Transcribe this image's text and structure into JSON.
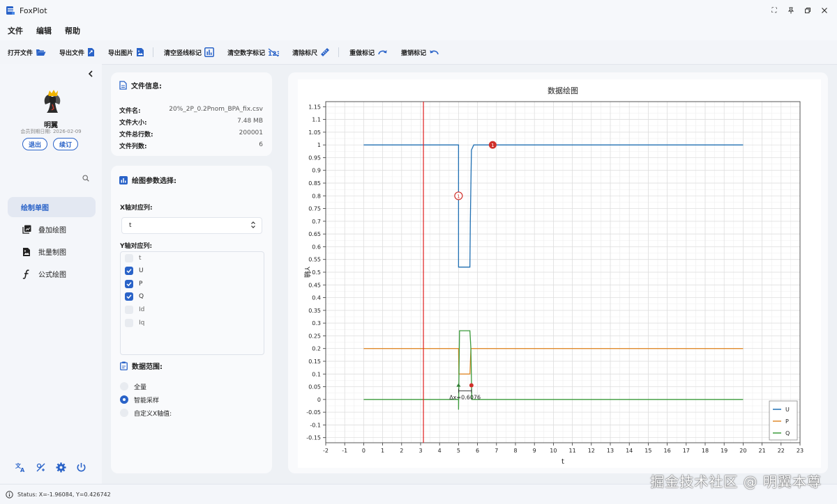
{
  "window": {
    "title": "FoxPlot",
    "controls": [
      "⛶",
      "📌",
      "🗗",
      "✕"
    ]
  },
  "menu": [
    "文件",
    "编辑",
    "帮助"
  ],
  "toolbar": {
    "open_file": "打开文件",
    "export_file": "导出文件",
    "export_image": "导出图片",
    "clear_vlines": "清空竖线标记",
    "clear_numbers": "清空数字标记",
    "clear_ruler": "清除标尺",
    "redo_mark": "重做标记",
    "undo_mark": "撤销标记"
  },
  "user": {
    "name": "明翼",
    "expire_label": "会员到期日期:",
    "expire_date": "2026-02-09",
    "logout": "退出",
    "renew": "续订"
  },
  "nav": [
    "绘制单图",
    "叠加绘图",
    "批量制图",
    "公式绘图"
  ],
  "file_info": {
    "title": "文件信息:",
    "rows": [
      {
        "k": "文件名:",
        "v": "20%_2P_0.2Pnom_BPA_fix.csv"
      },
      {
        "k": "文件大小:",
        "v": "7.48 MB"
      },
      {
        "k": "文件总行数:",
        "v": "200001"
      },
      {
        "k": "文件列数:",
        "v": "6"
      }
    ]
  },
  "params": {
    "title": "绘图参数选择:",
    "x_label": "X轴对应列:",
    "x_value": "t",
    "y_label": "Y轴对应列:",
    "y_columns": [
      {
        "name": "t",
        "checked": false
      },
      {
        "name": "U",
        "checked": true
      },
      {
        "name": "P",
        "checked": true
      },
      {
        "name": "Q",
        "checked": true
      },
      {
        "name": "Id",
        "checked": false
      },
      {
        "name": "Iq",
        "checked": false
      }
    ],
    "range_title": "数据范围:",
    "range_options": [
      {
        "name": "全量",
        "selected": false
      },
      {
        "name": "智能采样",
        "selected": true
      },
      {
        "name": "自定义X轴值:",
        "selected": false
      }
    ]
  },
  "status": "Status: X=-1.96084, Y=0.426742",
  "watermark": "掘金技术社区 @ 明翼本尊",
  "colors": {
    "accent": "#2a63c8",
    "U": "#1f6fb2",
    "P": "#e08a2c",
    "Q": "#3a9a3a",
    "marker": "#d0302a"
  },
  "chart_data": {
    "type": "line",
    "title": "数据绘图",
    "xlabel": "t",
    "ylabel": "Y轴",
    "xlim": [
      -2,
      23
    ],
    "ylim": [
      -0.17,
      1.17
    ],
    "xticks": [
      -2,
      -1,
      0,
      1,
      2,
      3,
      4,
      5,
      6,
      7,
      8,
      9,
      10,
      11,
      12,
      13,
      14,
      15,
      16,
      17,
      18,
      19,
      20,
      21,
      22,
      23
    ],
    "yticks": [
      -0.15,
      -0.1,
      -0.05,
      0,
      0.05,
      0.1,
      0.15,
      0.2,
      0.25,
      0.3,
      0.35,
      0.4,
      0.45,
      0.5,
      0.55,
      0.6,
      0.65,
      0.7,
      0.75,
      0.8,
      0.85,
      0.9,
      0.95,
      1,
      1.05,
      1.1,
      1.15
    ],
    "grid": true,
    "legend": "bottom-right",
    "series": [
      {
        "name": "U",
        "x": [
          0,
          5,
          5.0,
          5.02,
          5.6,
          5.62,
          5.68,
          5.8,
          20
        ],
        "y": [
          1,
          1,
          0.52,
          0.52,
          0.52,
          0.7,
          0.98,
          1,
          1
        ]
      },
      {
        "name": "P",
        "x": [
          0,
          5,
          5.02,
          5.6,
          5.65,
          20
        ],
        "y": [
          0.2,
          0.2,
          0.1,
          0.1,
          0.2,
          0.2
        ]
      },
      {
        "name": "Q",
        "x": [
          0,
          5,
          5.0,
          5.05,
          5.5,
          5.6,
          5.65,
          5.7,
          20
        ],
        "y": [
          0,
          0,
          -0.04,
          0.27,
          0.27,
          0.27,
          0.2,
          0,
          0
        ]
      }
    ],
    "vline_x": 3.15,
    "number_marks": [
      {
        "label": "1",
        "x": 5.0,
        "y": 0.8,
        "style": "hollow"
      },
      {
        "label": "1",
        "x": 6.8,
        "y": 1.0,
        "style": "filled"
      }
    ],
    "ruler": {
      "x1": 5.0,
      "x2": 5.68,
      "y": 0.05,
      "label": "Δx=0.6076"
    }
  }
}
